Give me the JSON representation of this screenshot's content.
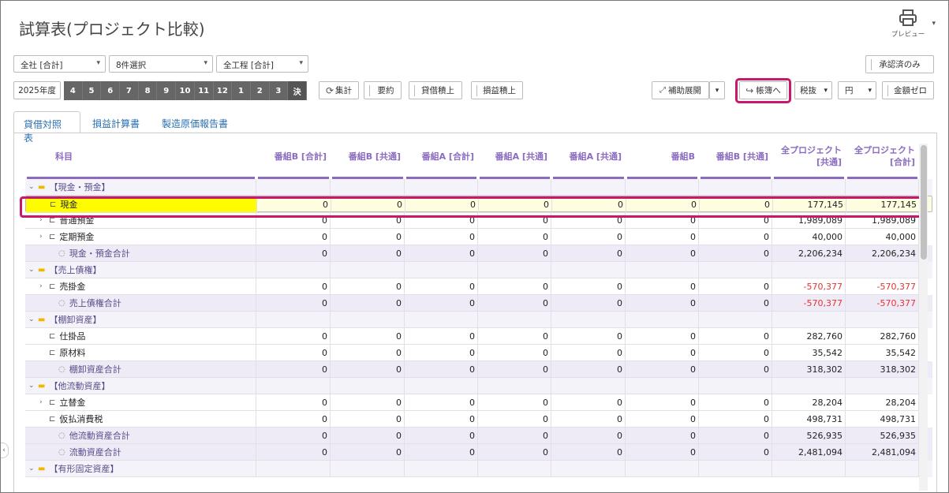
{
  "page": {
    "title": "試算表(プロジェクト比較)"
  },
  "preview": {
    "label": "プレビュー",
    "icon": "printer-icon"
  },
  "filters": {
    "company": "全社 [合計]",
    "projects": "8件選択",
    "process": "全工程 [合計]",
    "approved_only": "承認済のみ"
  },
  "toolbar": {
    "fiscal_year": "2025年度",
    "months": [
      "4",
      "5",
      "6",
      "7",
      "8",
      "9",
      "10",
      "11",
      "12",
      "1",
      "2",
      "3",
      "決"
    ],
    "aggregate": "集計",
    "summary": "要約",
    "debit_credit": "貸借積上",
    "profit_loss": "損益積上",
    "aux_expand": "補助展開",
    "to_ledger": "帳簿へ",
    "tax": "税抜",
    "unit": "円",
    "zero_amount": "金額ゼロ"
  },
  "tabs": [
    {
      "label": "貸借対照表",
      "active": true
    },
    {
      "label": "損益計算書",
      "active": false
    },
    {
      "label": "製造原価報告書",
      "active": false
    }
  ],
  "table": {
    "columns": [
      "科目",
      "番組B [合計]",
      "番組B [共通]",
      "番組A [合計]",
      "番組A [共通]",
      "番組A [共通]",
      "番組B",
      "番組B [共通]",
      "全プロジェクト [共通]",
      "全プロジェクト [合計]"
    ],
    "rows": [
      {
        "type": "group",
        "name": "【現金・預金】",
        "values": [
          "",
          "",
          "",
          "",
          "",
          "",
          "",
          "",
          ""
        ]
      },
      {
        "type": "item",
        "name": "現金",
        "selected": true,
        "values": [
          "0",
          "0",
          "0",
          "0",
          "0",
          "0",
          "0",
          "177,145",
          "177,145"
        ]
      },
      {
        "type": "item",
        "name": "普通預金",
        "expand": true,
        "values": [
          "0",
          "0",
          "0",
          "0",
          "0",
          "0",
          "0",
          "1,989,089",
          "1,989,089"
        ]
      },
      {
        "type": "item",
        "name": "定期預金",
        "expand": true,
        "values": [
          "0",
          "0",
          "0",
          "0",
          "0",
          "0",
          "0",
          "40,000",
          "40,000"
        ]
      },
      {
        "type": "total",
        "name": "現金・預金合計",
        "values": [
          "0",
          "0",
          "0",
          "0",
          "0",
          "0",
          "0",
          "2,206,234",
          "2,206,234"
        ]
      },
      {
        "type": "group",
        "name": "【売上債権】",
        "values": [
          "",
          "",
          "",
          "",
          "",
          "",
          "",
          "",
          ""
        ]
      },
      {
        "type": "item",
        "name": "売掛金",
        "expand": true,
        "values": [
          "0",
          "0",
          "0",
          "0",
          "0",
          "0",
          "0",
          "-570,377",
          "-570,377"
        ]
      },
      {
        "type": "total",
        "name": "売上債権合計",
        "values": [
          "0",
          "0",
          "0",
          "0",
          "0",
          "0",
          "0",
          "-570,377",
          "-570,377"
        ]
      },
      {
        "type": "group",
        "name": "【棚卸資産】",
        "values": [
          "",
          "",
          "",
          "",
          "",
          "",
          "",
          "",
          ""
        ]
      },
      {
        "type": "item",
        "name": "仕掛品",
        "values": [
          "0",
          "0",
          "0",
          "0",
          "0",
          "0",
          "0",
          "282,760",
          "282,760"
        ]
      },
      {
        "type": "item",
        "name": "原材料",
        "values": [
          "0",
          "0",
          "0",
          "0",
          "0",
          "0",
          "0",
          "35,542",
          "35,542"
        ]
      },
      {
        "type": "total",
        "name": "棚卸資産合計",
        "values": [
          "0",
          "0",
          "0",
          "0",
          "0",
          "0",
          "0",
          "318,302",
          "318,302"
        ]
      },
      {
        "type": "group",
        "name": "【他流動資産】",
        "values": [
          "",
          "",
          "",
          "",
          "",
          "",
          "",
          "",
          ""
        ]
      },
      {
        "type": "item",
        "name": "立替金",
        "expand": true,
        "values": [
          "0",
          "0",
          "0",
          "0",
          "0",
          "0",
          "0",
          "28,204",
          "28,204"
        ]
      },
      {
        "type": "item",
        "name": "仮払消費税",
        "values": [
          "0",
          "0",
          "0",
          "0",
          "0",
          "0",
          "0",
          "498,731",
          "498,731"
        ]
      },
      {
        "type": "total",
        "name": "他流動資産合計",
        "values": [
          "0",
          "0",
          "0",
          "0",
          "0",
          "0",
          "0",
          "526,935",
          "526,935"
        ]
      },
      {
        "type": "total",
        "name": "流動資産合計",
        "values": [
          "0",
          "0",
          "0",
          "0",
          "0",
          "0",
          "0",
          "2,481,094",
          "2,481,094"
        ]
      },
      {
        "type": "group",
        "name": "【有形固定資産】",
        "values": [
          "",
          "",
          "",
          "",
          "",
          "",
          "",
          "",
          ""
        ]
      }
    ]
  }
}
